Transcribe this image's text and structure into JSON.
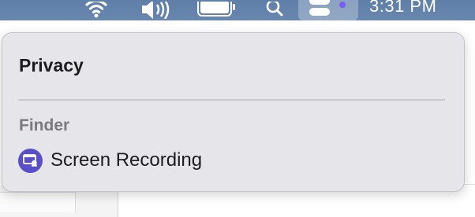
{
  "menubar": {
    "clock": "3:31 PM",
    "icons": [
      "wifi-icon",
      "volume-icon",
      "battery-icon",
      "search-icon",
      "control-center-icon"
    ],
    "privacy_dot_color": "#7b5bff"
  },
  "popover": {
    "title": "Privacy",
    "section": "Finder",
    "items": [
      {
        "label": "Screen Recording",
        "icon": "screen-recording-icon",
        "icon_color": "#5b4fc9"
      }
    ]
  }
}
